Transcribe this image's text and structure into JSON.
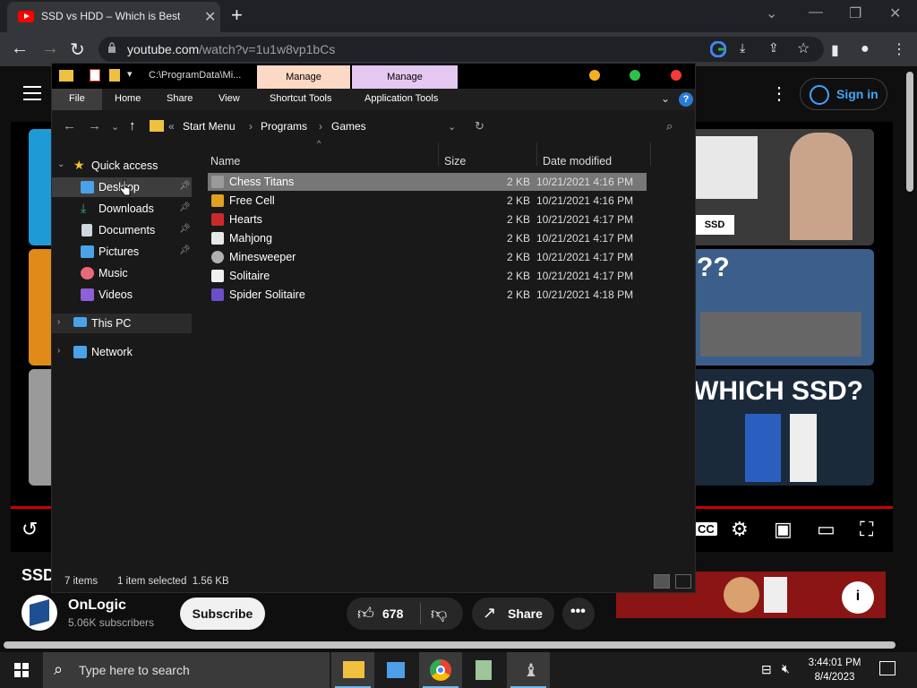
{
  "browser": {
    "tab_title": "SSD vs HDD – Which is Best for Yo",
    "url_host": "youtube.com",
    "url_path": "/watch?v=1u1w8vp1bCs"
  },
  "youtube": {
    "sign_in": "Sign in",
    "video_title_partial": "SSD",
    "channel_name": "OnLogic",
    "subscribers": "5.06K subscribers",
    "subscribe_label": "Subscribe",
    "likes": "678",
    "share_label": "Share",
    "end_thumbs": [
      {
        "caption": "SSD"
      },
      {
        "caption": "??"
      },
      {
        "caption": "WHICH SSD?"
      }
    ]
  },
  "explorer": {
    "title_path": "C:\\ProgramData\\Mi...",
    "context_tabs": [
      {
        "label": "Manage",
        "color": "#fcd9c4"
      },
      {
        "label": "Manage",
        "color": "#e4c8f2"
      }
    ],
    "ribbon_tabs": [
      "File",
      "Home",
      "Share",
      "View",
      "Shortcut Tools",
      "Application Tools"
    ],
    "breadcrumb": [
      "Start Menu",
      "Programs",
      "Games"
    ],
    "nav_items": [
      {
        "label": "Quick access",
        "icon": "star-icon",
        "color": "#f2c12e"
      },
      {
        "label": "Desktop",
        "icon": "desktop-icon",
        "color": "#4aa3e8"
      },
      {
        "label": "Downloads",
        "icon": "download-icon",
        "color": "#3cb371"
      },
      {
        "label": "Documents",
        "icon": "document-icon",
        "color": "#cfd6de"
      },
      {
        "label": "Pictures",
        "icon": "pictures-icon",
        "color": "#4aa3e8"
      },
      {
        "label": "Music",
        "icon": "music-icon",
        "color": "#e86a7a"
      },
      {
        "label": "Videos",
        "icon": "video-icon",
        "color": "#8e5fd6"
      },
      {
        "label": "This PC",
        "icon": "computer-icon",
        "color": "#4aa3e8"
      },
      {
        "label": "Network",
        "icon": "network-icon",
        "color": "#4aa3e8"
      }
    ],
    "columns": [
      "Name",
      "Size",
      "Date modified"
    ],
    "files": [
      {
        "name": "Chess Titans",
        "size": "2 KB",
        "date": "10/21/2021 4:16 PM",
        "icon_color": "#9a9a9a"
      },
      {
        "name": "Free Cell",
        "size": "2 KB",
        "date": "10/21/2021 4:16 PM",
        "icon_color": "#e0a020"
      },
      {
        "name": "Hearts",
        "size": "2 KB",
        "date": "10/21/2021 4:17 PM",
        "icon_color": "#cc2a2a"
      },
      {
        "name": "Mahjong",
        "size": "2 KB",
        "date": "10/21/2021 4:17 PM",
        "icon_color": "#e8e8e8"
      },
      {
        "name": "Minesweeper",
        "size": "2 KB",
        "date": "10/21/2021 4:17 PM",
        "icon_color": "#b0b0b0"
      },
      {
        "name": "Solitaire",
        "size": "2 KB",
        "date": "10/21/2021 4:17 PM",
        "icon_color": "#f0f0f0"
      },
      {
        "name": "Spider Solitaire",
        "size": "2 KB",
        "date": "10/21/2021 4:18 PM",
        "icon_color": "#6a4fc8"
      }
    ],
    "status_items": "7 items",
    "status_selected": "1 item selected  1.56 KB"
  },
  "taskbar": {
    "search_placeholder": "Type here to search",
    "time": "3:44:01 PM",
    "date": "8/4/2023"
  }
}
